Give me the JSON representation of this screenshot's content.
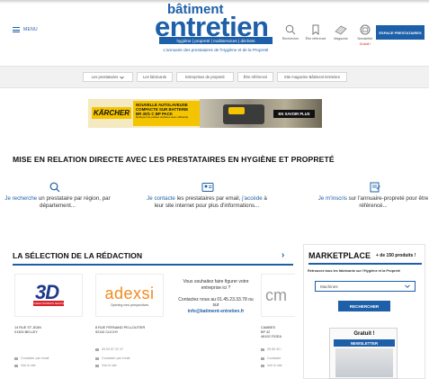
{
  "header": {
    "menu_label": "MENU",
    "logo_top": "bâtiment",
    "logo_main": "entretien",
    "logo_tagline": "hygiène | propreté | multiservices | déchets",
    "logo_subtitle": "L'annuaire des prestataires de l'Hygiène et de la Propreté",
    "icons": [
      {
        "name": "search-icon",
        "label": "Rechercher"
      },
      {
        "name": "bookmark-icon",
        "label": "Être référencé"
      },
      {
        "name": "magazine-icon",
        "label": "Magazine"
      },
      {
        "name": "newsletter-icon",
        "label": "Newsletter",
        "badge": "Gratuit !"
      }
    ],
    "espace_button": "ESPACE PRESTATAIRES"
  },
  "nav": {
    "items": [
      "Les prestataires",
      "Les fabricants",
      "Entreprises de propreté",
      "Être référencé",
      "Site magazine Bâtiment Entretien"
    ]
  },
  "banner": {
    "brand": "KÄRCHER",
    "line1": "NOUVELLE AUTOLAVEUSE",
    "line2": "COMPACTE SUR BATTERIE",
    "line3": "BR 30/1 C BP PACK",
    "fine_print": "Nettoyez les petites surfaces avec efficacité",
    "cta": "EN SAVOIR PLUS"
  },
  "headline": "MISE EN RELATION DIRECTE AVEC LES PRESTATAIRES EN HYGIÈNE ET PROPRETÉ",
  "features": [
    {
      "icon": "search-icon",
      "highlight": "Je recherche",
      "text": " un prestataire par région, par département..."
    },
    {
      "icon": "contact-card-icon",
      "highlight": "Je contacte",
      "text": " les prestataires par email, ",
      "highlight2": "j'accède",
      "text2": " à leur site internet pour plus d'informations..."
    },
    {
      "icon": "register-icon",
      "highlight": "Je m'inscris",
      "text": " sur l'annuaire-propreté pour être référencé..."
    }
  ],
  "selection": {
    "title": "LA SÉLECTION DE LA RÉDACTION",
    "cards": [
      {
        "logo_text": "3D",
        "logo_ribbon": "HYGIENE PROPRETE SERVICES",
        "address1": "14 RUE ST JEAN",
        "address2": "01300 BELLEY",
        "contact": "Contacter par email",
        "site": "Voir le site"
      },
      {
        "logo_text": "adexsi",
        "logo_tagline": "Opening new perspectives",
        "address1": "8 RUE FERNAND PELLOUTIER",
        "address2": "92110 CLICHY",
        "phone": "09 53 57 22 47",
        "contact": "Contacter par email",
        "site": "Voir le site"
      },
      {
        "address1": "CAMBES",
        "address2": "BP 42",
        "address3": "46192 FIGEA",
        "phone": "05 65 40 /",
        "contact": "Contacter",
        "site": "Voir le site",
        "logo_text": "cm"
      }
    ],
    "contact_card": {
      "text": "Vous souhaitez faire figurer votre entreprise ici ?",
      "call": "Contactez nous au 01.45.23.33.78 ou sur",
      "email": "info@batiment-entretien.fr"
    }
  },
  "marketplace": {
    "title": "MARKETPLACE",
    "count": "+ de 150 produits !",
    "description": "Retrouvez tous les fabricants sur l'Hygiène et la Propreté",
    "select_value": "Machines",
    "button": "RECHERCHER",
    "newsletter_free": "Gratuit !",
    "newsletter_label": "NEWSLETTER"
  }
}
